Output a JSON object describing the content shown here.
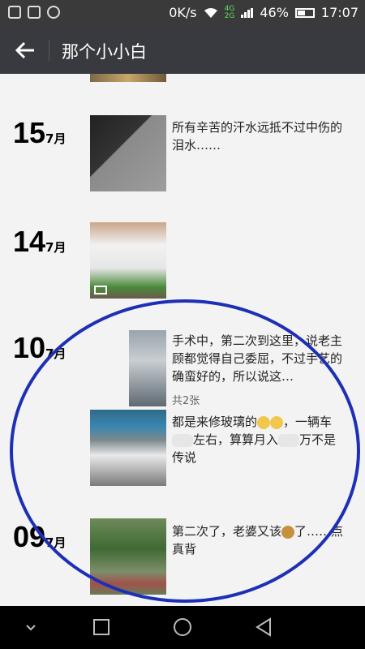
{
  "status_bar": {
    "speed": "0K/s",
    "network": "4G",
    "network2": "2G",
    "battery": "46%",
    "time": "17:07"
  },
  "header": {
    "title": "那个小小白"
  },
  "posts": [
    {
      "day": "15",
      "month": "7月",
      "text": "所有辛苦的汗水远抵不过中伤的泪水……"
    },
    {
      "day": "14",
      "month": "7月",
      "text": ""
    },
    {
      "day": "10",
      "month": "7月",
      "text": "手术中，第二次到这里，说老主顾都觉得自己委屈，不过手艺的确蛮好的，所以说这…",
      "count": "共2张",
      "text2a": "都是来修玻璃的",
      "text2b": "，一辆车",
      "text2c": "左右，算算月入",
      "text2d": "万不是传说"
    },
    {
      "day": "09",
      "month": "7月",
      "text_a": "第二次了，老婆又该",
      "text_b": "了……点真背"
    }
  ]
}
